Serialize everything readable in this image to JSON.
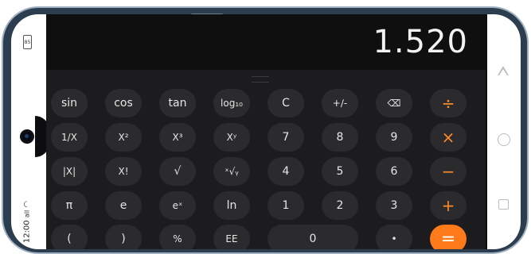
{
  "status": {
    "time": "12:00",
    "signal": "all",
    "battery": "85"
  },
  "display": {
    "value": "1.520"
  },
  "keys": {
    "sin": "sin",
    "cos": "cos",
    "tan": "tan",
    "log": "log₁₀",
    "clear": "C",
    "plus_minus": "+∕-",
    "backspace": "⌫",
    "divide": "÷",
    "inverse": "1/X",
    "square": "X²",
    "cube": "X³",
    "power": "Xʸ",
    "seven": "7",
    "eight": "8",
    "nine": "9",
    "multiply": "×",
    "abs": "|X|",
    "factorial": "X!",
    "sqrt": "√",
    "root": "ˣ√ᵧ",
    "four": "4",
    "five": "5",
    "six": "6",
    "minus": "−",
    "pi": "π",
    "e": "e",
    "exp": "eˣ",
    "ln": "ln",
    "one": "1",
    "two": "2",
    "three": "3",
    "plus": "+",
    "lparen": "(",
    "rparen": ")",
    "percent": "%",
    "ee": "EE",
    "zero": "0",
    "dot": "•",
    "equals": "="
  },
  "colors": {
    "accent": "#ff7a1a",
    "key_bg": "#2b2b2d",
    "calc_bg": "#1c1c1e"
  }
}
